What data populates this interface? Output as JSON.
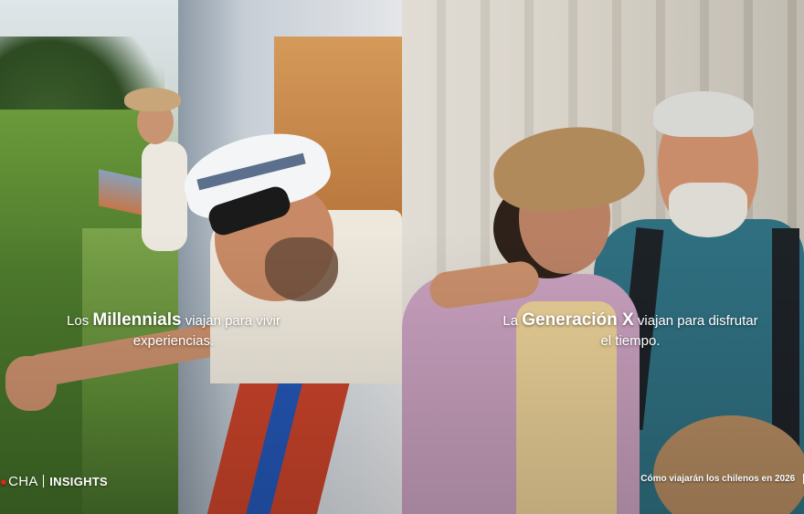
{
  "left_panel": {
    "caption": {
      "prefix": "Los",
      "highlight": "Millennials",
      "line1_rest": "viajan para vivir",
      "line2": "experiencias."
    }
  },
  "right_panel": {
    "caption": {
      "prefix": "La",
      "highlight": "Generación X",
      "line1_rest": "viajan para disfrutar",
      "line2": "el tiempo."
    }
  },
  "brand": {
    "logo_text": "CHA",
    "label": "INSIGHTS",
    "accent_color": "#e2231a"
  },
  "footer": {
    "text": "Cómo viajarán los chilenos en 2026"
  }
}
